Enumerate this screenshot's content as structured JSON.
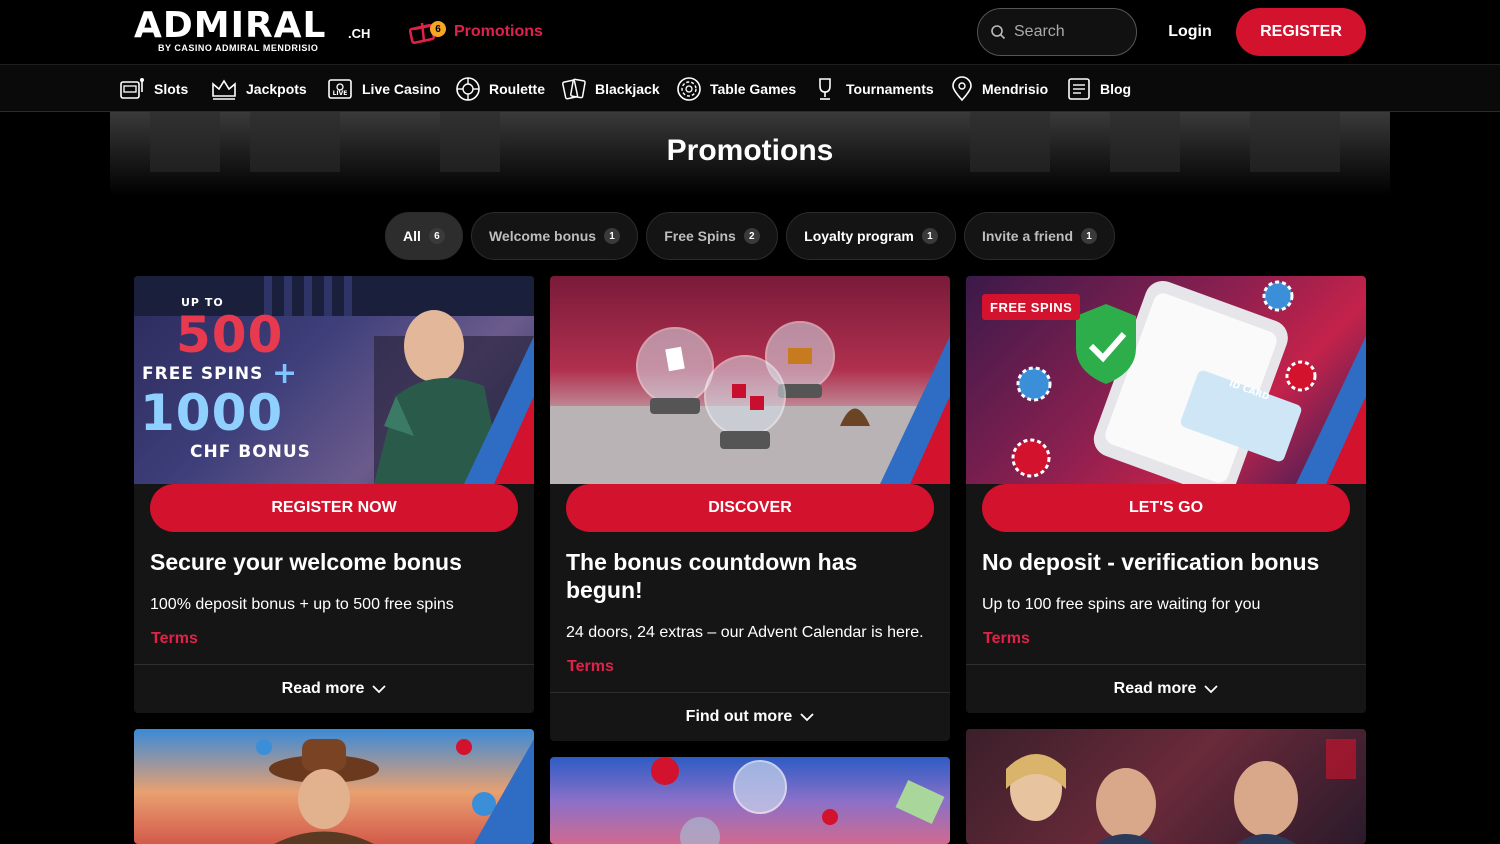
{
  "header": {
    "logo_main": "ADMIRAL",
    "logo_tld": ".CH",
    "logo_sub": "BY CASINO ADMIRAL MENDRISIO",
    "promotions_label": "Promotions",
    "promotions_count": "6",
    "search_placeholder": "Search",
    "login_label": "Login",
    "register_label": "REGISTER"
  },
  "categories": [
    {
      "label": "Slots",
      "icon": "slot-machine-icon"
    },
    {
      "label": "Jackpots",
      "icon": "crown-icon"
    },
    {
      "label": "Live Casino",
      "icon": "live-casino-icon"
    },
    {
      "label": "Roulette",
      "icon": "roulette-icon"
    },
    {
      "label": "Blackjack",
      "icon": "cards-icon"
    },
    {
      "label": "Table Games",
      "icon": "chip-icon"
    },
    {
      "label": "Tournaments",
      "icon": "trophy-icon"
    },
    {
      "label": "Mendrisio",
      "icon": "location-pin-icon"
    },
    {
      "label": "Blog",
      "icon": "document-icon"
    }
  ],
  "page_title": "Promotions",
  "filters": [
    {
      "label": "All",
      "count": "6"
    },
    {
      "label": "Welcome bonus",
      "count": "1"
    },
    {
      "label": "Free Spins",
      "count": "2"
    },
    {
      "label": "Loyalty program",
      "count": "1"
    },
    {
      "label": "Invite a friend",
      "count": "1"
    }
  ],
  "cards": [
    {
      "banner": {
        "up_to": "UP TO",
        "spins": "500",
        "spins_label": "FREE SPINS",
        "plus": "+",
        "bonus": "1000",
        "bonus_label": "CHF BONUS"
      },
      "cta": "REGISTER NOW",
      "title": "Secure your welcome bonus",
      "desc": "100% deposit bonus + up to 500 free spins",
      "terms": "Terms",
      "footer": "Read more"
    },
    {
      "cta": "DISCOVER",
      "title": "The bonus countdown has begun!",
      "desc": "24 doors, 24 extras – our Advent Calendar is here.",
      "terms": "Terms",
      "footer": "Find out more"
    },
    {
      "banner": {
        "tag": "FREE SPINS",
        "id_card": "ID CARD"
      },
      "cta": "LET'S GO",
      "title": "No deposit - verification bonus",
      "desc": "Up to 100 free spins are waiting for you",
      "terms": "Terms",
      "footer": "Read more"
    }
  ],
  "colors": {
    "brand_red": "#d3122d",
    "terms_pink": "#e0214a",
    "badge_orange": "#f5a623"
  }
}
